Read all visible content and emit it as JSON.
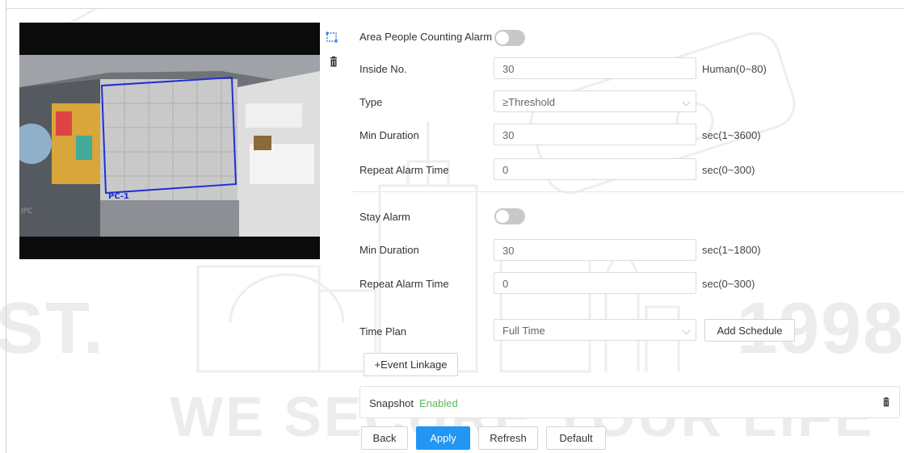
{
  "watermark": {
    "left_text": "ST.",
    "year": "1998",
    "slogan": "WE SECURE YOUR LIFE"
  },
  "video": {
    "region_label": "PC-1",
    "corner_tag": "IPC"
  },
  "area_alarm": {
    "label": "Area People Counting Alarm",
    "enabled": false
  },
  "inside_no": {
    "label": "Inside No.",
    "value": "30",
    "unit": "Human(0~80)"
  },
  "type": {
    "label": "Type",
    "value": "≥Threshold"
  },
  "min_duration_1": {
    "label": "Min Duration",
    "value": "30",
    "unit": "sec(1~3600)"
  },
  "repeat_alarm_1": {
    "label": "Repeat Alarm Time",
    "value": "0",
    "unit": "sec(0~300)"
  },
  "stay_alarm": {
    "label": "Stay Alarm",
    "enabled": false
  },
  "min_duration_2": {
    "label": "Min Duration",
    "value": "30",
    "unit": "sec(1~1800)"
  },
  "repeat_alarm_2": {
    "label": "Repeat Alarm Time",
    "value": "0",
    "unit": "sec(0~300)"
  },
  "time_plan": {
    "label": "Time Plan",
    "value": "Full Time",
    "add_schedule_label": "Add Schedule"
  },
  "event_linkage": {
    "label": "+Event Linkage"
  },
  "snapshot": {
    "label": "Snapshot",
    "status": "Enabled"
  },
  "actions": {
    "back": "Back",
    "apply": "Apply",
    "refresh": "Refresh",
    "default": "Default"
  },
  "colors": {
    "primary": "#2196f3",
    "status_enabled": "#5ab95a",
    "region_outline": "#1f2fd6",
    "toggle_off": "#c8c8c8"
  },
  "icons": [
    "draw-region-icon",
    "delete-icon",
    "chevron-down-icon",
    "trash-icon"
  ]
}
